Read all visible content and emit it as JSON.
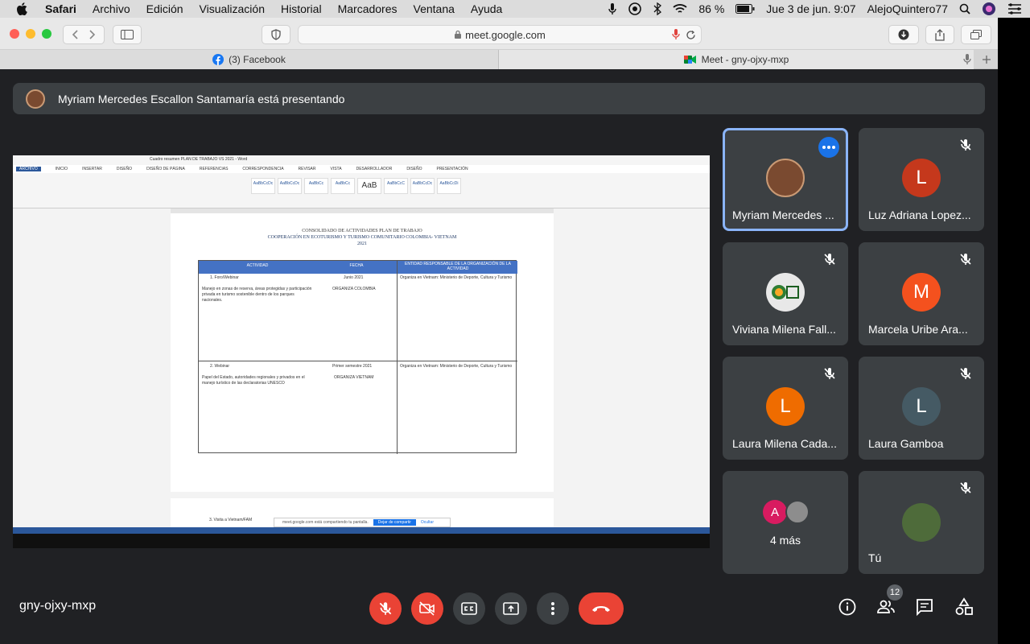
{
  "menubar": {
    "app": "Safari",
    "items": [
      "Archivo",
      "Edición",
      "Visualización",
      "Historial",
      "Marcadores",
      "Ventana",
      "Ayuda"
    ],
    "battery": "86 %",
    "datetime": "Jue 3 de jun.  9:07",
    "user": "AlejoQuintero77"
  },
  "browser": {
    "url": "meet.google.com",
    "tabs": [
      {
        "label": "(3) Facebook"
      },
      {
        "label": "Meet - gny-ojxy-mxp"
      }
    ]
  },
  "banner": {
    "text": "Myriam Mercedes Escallon Santamaría está presentando"
  },
  "shared_doc": {
    "window_title": "Cuadro resumen PLAN DE TRABAJO VS 2021 - Word",
    "ribbon_tabs": [
      "ARCHIVO",
      "INICIO",
      "INSERTAR",
      "DISEÑO",
      "DISEÑO DE PÁGINA",
      "REFERENCIAS",
      "CORRESPONDENCIA",
      "REVISAR",
      "VISTA",
      "DESARROLLADOR",
      "DISEÑO",
      "PRESENTACIÓN"
    ],
    "styles": [
      "AaBbCcDc",
      "AaBbCcDc",
      "AaBbCc",
      "AaBbCc",
      "AaB",
      "AaBbCcC",
      "AaBbCcDc",
      "AaBbCcDi"
    ],
    "title_lines": [
      "CONSOLIDADO DE ACTIVIDADES PLAN DE TRABAJO",
      "COOPERACIÓN  EN ECOTURISMO Y TURISMO COMUNITARIO COLOMBIA- VIETNAM",
      "2021"
    ],
    "table_headers": [
      "ACTIVIDAD",
      "FECHA",
      "ENTIDAD RESPONSABLE DE LA ORGANIZACIÓN DE LA ACTIVIDAD"
    ],
    "row1": {
      "activity": "1.   Foro/Webinar",
      "desc": "Manejo en zonas de reserva, áreas protegidas y participación privada en turismo sostenible dentro de los parques nacionales.",
      "date": "Junio 2021",
      "org": "ORGANIZA COLOMBIA",
      "entity": "Organiza en Vietnam: Ministerio de Deporte, Cultura y Turismo"
    },
    "row2": {
      "activity": "2.   Webinar",
      "desc": "Papel del Estado, autoridades regionales y privados en el manejo turístico de las declaratorias UNESCO",
      "date": "Primer semestre 2021",
      "org": "ORGANIZA VIETNAM",
      "entity": "Organiza en Vietnam: Ministerio de Deporte, Cultura y Turismo"
    },
    "row3_activity": "3.   Visita a  Vietnam/FAM",
    "notify_text": "meet.google.com está compartiendo tu pantalla.",
    "notify_stop": "Dejar de compartir",
    "notify_hide": "Ocultar"
  },
  "participants": [
    {
      "name": "Myriam Mercedes ...",
      "initial": "",
      "color": "#7a4a30"
    },
    {
      "name": "Luz Adriana Lopez...",
      "initial": "L",
      "color": "#c5381c"
    },
    {
      "name": "Viviana Milena Fall...",
      "initial": "",
      "color": "#3c4043"
    },
    {
      "name": "Marcela Uribe Ara...",
      "initial": "M",
      "color": "#f4511e"
    },
    {
      "name": "Laura Milena Cada...",
      "initial": "L",
      "color": "#ef6c00"
    },
    {
      "name": "Laura Gamboa",
      "initial": "L",
      "color": "#455a64"
    },
    {
      "name": "4 más",
      "initial": "A",
      "color": "#d81b60"
    },
    {
      "name": "Tú",
      "initial": "",
      "color": "#4e6b3a"
    }
  ],
  "bottom": {
    "meeting_code": "gny-ojxy-mxp",
    "participant_count": "12"
  },
  "colors": {
    "meet_bg": "#202124",
    "tile_bg": "#3c4043",
    "danger": "#ea4335",
    "active_border": "#8ab4f8"
  }
}
